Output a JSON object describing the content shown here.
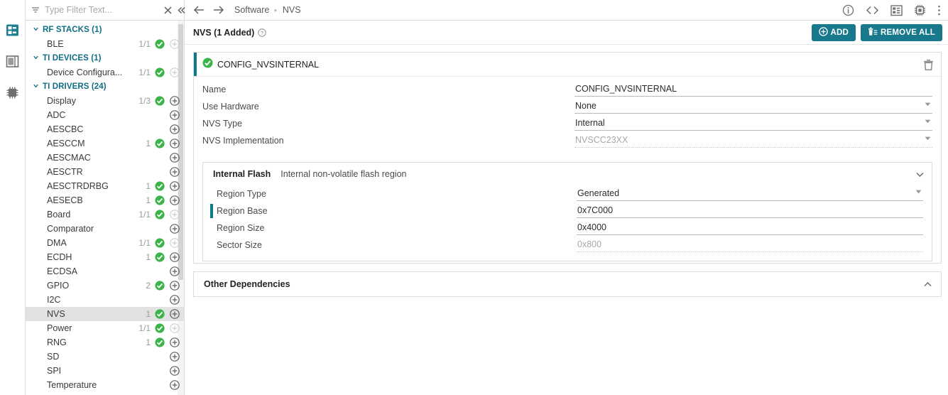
{
  "rail": {
    "items": [
      {
        "name": "software-components-icon",
        "active": true
      },
      {
        "name": "table-view-icon",
        "active": false
      },
      {
        "name": "chip-hardware-icon",
        "active": false
      }
    ]
  },
  "sidebar": {
    "filter": {
      "placeholder": "Type Filter Text...",
      "value": "",
      "filter_icon": "filter-icon",
      "clear_icon": "clear-x-icon",
      "collapse_icon": "collapse-left-icon"
    },
    "groups": [
      {
        "label": "RF STACKS (1)",
        "expanded": true,
        "items": [
          {
            "label": "BLE",
            "count": "1/1",
            "checked": true,
            "add_enabled": false,
            "selected": false
          }
        ]
      },
      {
        "label": "TI DEVICES (1)",
        "expanded": true,
        "items": [
          {
            "label": "Device Configura...",
            "count": "1/1",
            "checked": true,
            "add_enabled": false,
            "selected": false
          }
        ]
      },
      {
        "label": "TI DRIVERS (24)",
        "expanded": true,
        "items": [
          {
            "label": "Display",
            "count": "1/3",
            "checked": true,
            "add_enabled": true,
            "selected": false
          },
          {
            "label": "ADC",
            "count": "",
            "checked": false,
            "add_enabled": true,
            "selected": false
          },
          {
            "label": "AESCBC",
            "count": "",
            "checked": false,
            "add_enabled": true,
            "selected": false
          },
          {
            "label": "AESCCM",
            "count": "1",
            "checked": true,
            "add_enabled": true,
            "selected": false
          },
          {
            "label": "AESCMAC",
            "count": "",
            "checked": false,
            "add_enabled": true,
            "selected": false
          },
          {
            "label": "AESCTR",
            "count": "",
            "checked": false,
            "add_enabled": true,
            "selected": false
          },
          {
            "label": "AESCTRDRBG",
            "count": "1",
            "checked": true,
            "add_enabled": true,
            "selected": false
          },
          {
            "label": "AESECB",
            "count": "1",
            "checked": true,
            "add_enabled": true,
            "selected": false
          },
          {
            "label": "Board",
            "count": "1/1",
            "checked": true,
            "add_enabled": false,
            "selected": false
          },
          {
            "label": "Comparator",
            "count": "",
            "checked": false,
            "add_enabled": true,
            "selected": false
          },
          {
            "label": "DMA",
            "count": "1/1",
            "checked": true,
            "add_enabled": false,
            "selected": false
          },
          {
            "label": "ECDH",
            "count": "1",
            "checked": true,
            "add_enabled": true,
            "selected": false
          },
          {
            "label": "ECDSA",
            "count": "",
            "checked": false,
            "add_enabled": true,
            "selected": false
          },
          {
            "label": "GPIO",
            "count": "2",
            "checked": true,
            "add_enabled": true,
            "selected": false
          },
          {
            "label": "I2C",
            "count": "",
            "checked": false,
            "add_enabled": true,
            "selected": false
          },
          {
            "label": "NVS",
            "count": "1",
            "checked": true,
            "add_enabled": true,
            "selected": true
          },
          {
            "label": "Power",
            "count": "1/1",
            "checked": true,
            "add_enabled": false,
            "selected": false
          },
          {
            "label": "RNG",
            "count": "1",
            "checked": true,
            "add_enabled": true,
            "selected": false
          },
          {
            "label": "SD",
            "count": "",
            "checked": false,
            "add_enabled": true,
            "selected": false
          },
          {
            "label": "SPI",
            "count": "",
            "checked": false,
            "add_enabled": true,
            "selected": false
          },
          {
            "label": "Temperature",
            "count": "",
            "checked": false,
            "add_enabled": true,
            "selected": false
          }
        ]
      }
    ]
  },
  "topbar": {
    "back_icon": "arrow-left-icon",
    "forward_icon": "arrow-right-icon",
    "breadcrumbs": [
      "Software",
      "NVS"
    ],
    "icons": [
      {
        "name": "info-icon"
      },
      {
        "name": "code-brackets-icon"
      },
      {
        "name": "software-components-icon"
      },
      {
        "name": "chip-hardware-icon"
      },
      {
        "name": "more-vertical-icon"
      }
    ]
  },
  "subbar": {
    "title": "NVS (1 Added)",
    "help_icon": "help-circle-icon",
    "add_label": "ADD",
    "remove_all_label": "REMOVE ALL",
    "accent_color": "#18798c"
  },
  "instance": {
    "status_icon": "check-circle-icon",
    "title": "CONFIG_NVSINTERNAL",
    "delete_icon": "trash-icon",
    "fields": [
      {
        "label": "Name",
        "value": "CONFIG_NVSINTERNAL",
        "type": "text",
        "disabled": false,
        "marked": false
      },
      {
        "label": "Use Hardware",
        "value": "None",
        "type": "select",
        "disabled": false,
        "marked": false
      },
      {
        "label": "NVS Type",
        "value": "Internal",
        "type": "select",
        "disabled": false,
        "marked": false
      },
      {
        "label": "NVS Implementation",
        "value": "NVSCC23XX",
        "type": "select",
        "disabled": true,
        "marked": false
      }
    ],
    "section": {
      "title": "Internal Flash",
      "description": "Internal non-volatile flash region",
      "collapse_icon": "chevron-down-icon",
      "fields": [
        {
          "label": "Region Type",
          "value": "Generated",
          "type": "select",
          "disabled": false,
          "marked": false
        },
        {
          "label": "Region Base",
          "value": "0x7C000",
          "type": "text",
          "disabled": false,
          "marked": true
        },
        {
          "label": "Region Size",
          "value": "0x4000",
          "type": "text",
          "disabled": false,
          "marked": false
        },
        {
          "label": "Sector Size",
          "value": "0x800",
          "type": "text",
          "disabled": true,
          "marked": false
        }
      ]
    }
  },
  "dependencies": {
    "title": "Other Dependencies",
    "collapse_icon": "chevron-up-icon"
  }
}
